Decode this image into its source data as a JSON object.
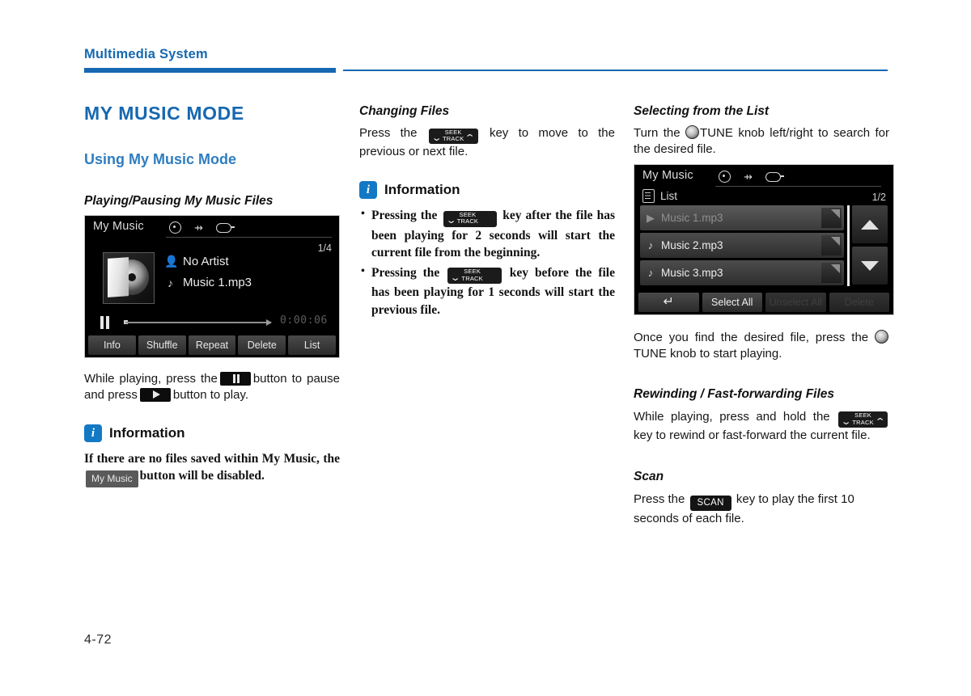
{
  "runhead": {
    "chapter": "Multimedia System"
  },
  "folio": "4-72",
  "colors": {
    "accent": "#1668b0",
    "subheading": "#2f7dc0",
    "info_badge": "#1479c4"
  },
  "left": {
    "main_title": "MY MUSIC MODE",
    "sub_title": "Using My Music Mode",
    "section_title": "Playing/Pausing My Music Files",
    "player_screen": {
      "title": "My Music",
      "icons": [
        "disc-icon",
        "usb-icon",
        "aux-icon"
      ],
      "page_indicator": "1/4",
      "artist": "No Artist",
      "track": "Music 1.mp3",
      "time": "0:00:06",
      "buttons": [
        "Info",
        "Shuffle",
        "Repeat",
        "Delete",
        "List"
      ]
    },
    "paragraph_parts": {
      "p1": "While playing, press the",
      "p2": "button to pause and press",
      "p3": "button to play."
    },
    "info": {
      "badge": "i",
      "title": "Information",
      "body_parts": {
        "b1": "If there are no files saved within My Music, the",
        "b2": "button will be disabled."
      },
      "key_my_music": "My Music"
    }
  },
  "middle": {
    "section_title": "Changing Files",
    "paragraph_parts": {
      "p1": "Press the",
      "p2": "key to move to the previous or next file."
    },
    "info": {
      "badge": "i",
      "title": "Information",
      "bullets": [
        {
          "pre": "Pressing the",
          "post": "key after the file has been playing for 2 seconds will start the current file from the beginning."
        },
        {
          "pre": "Pressing the",
          "post": "key before the file has been playing for 1 seconds will start the previous file."
        }
      ]
    }
  },
  "right": {
    "section_title": "Selecting from the List",
    "paragraph_parts": {
      "p1": "Turn the",
      "p2": "TUNE knob left/right to search for the desired file."
    },
    "list_screen": {
      "title": "My Music",
      "icons": [
        "disc-icon",
        "usb-icon",
        "aux-icon"
      ],
      "sub_label": "List",
      "page_indicator": "1/2",
      "rows": [
        {
          "label": "Music 1.mp3",
          "icon": "play-icon",
          "state": "playing"
        },
        {
          "label": "Music 2.mp3",
          "icon": "note-icon",
          "state": "normal"
        },
        {
          "label": "Music 3.mp3",
          "icon": "note-icon",
          "state": "normal"
        }
      ],
      "scroll_up": "scroll-up-arrow",
      "scroll_down": "scroll-down-arrow",
      "buttons": [
        {
          "label": "",
          "icon": "back-arrow-icon",
          "disabled": false
        },
        {
          "label": "Select All",
          "disabled": false
        },
        {
          "label": "Unselect All",
          "disabled": true
        },
        {
          "label": "Delete",
          "disabled": true
        }
      ]
    },
    "after_list_parts": {
      "p1": "Once you find the desired file, press the",
      "p2": "TUNE knob to start playing."
    },
    "rewind_title": "Rewinding / Fast-forwarding Files",
    "rewind_parts": {
      "p1": "While playing, press and hold the",
      "p2": "key to rewind or fast-forward the current file."
    },
    "scan_title": "Scan",
    "scan_parts": {
      "p1": "Press the",
      "p2": "key to play the first 10 seconds of each file."
    },
    "key_scan": "SCAN"
  },
  "keys": {
    "seek_top": "SEEK",
    "seek_bottom": "TRACK",
    "chev_down": "⌄",
    "chev_up": "⌃"
  }
}
